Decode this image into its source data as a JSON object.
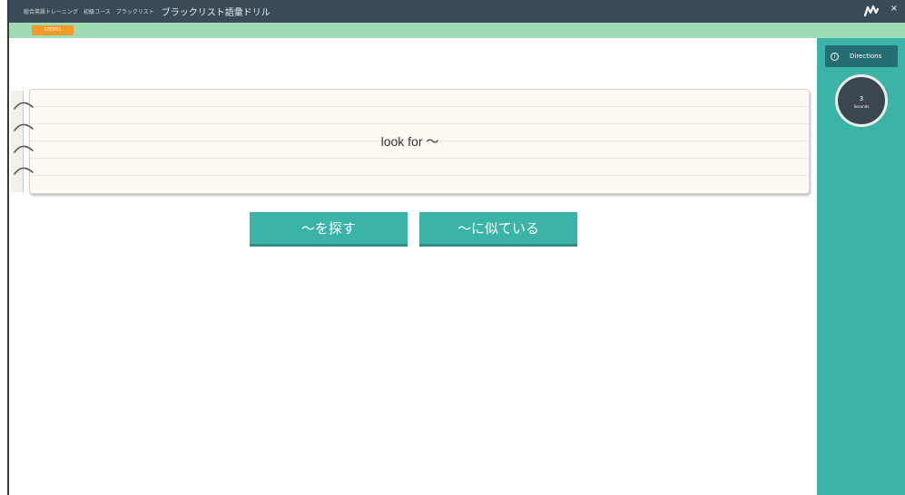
{
  "titlebar": {
    "crumbs": [
      "総合英語トレーニング",
      "初級コース",
      "ブラックリスト"
    ],
    "app_title": "ブラックリスト語彙ドリル",
    "close_label": "×"
  },
  "stepbar": {
    "step_label": "STEP01"
  },
  "card": {
    "word": "look for ～"
  },
  "choices": [
    {
      "label": "～を探す"
    },
    {
      "label": "～に似ている"
    }
  ],
  "sidebar": {
    "directions_label": "Directions",
    "timer_value": "3",
    "timer_unit": "Seconds"
  },
  "colors": {
    "titlebar": "#3b4a57",
    "stepbar": "#9fdcb3",
    "accent": "#3bb3a6",
    "badge": "#f49a2b"
  }
}
